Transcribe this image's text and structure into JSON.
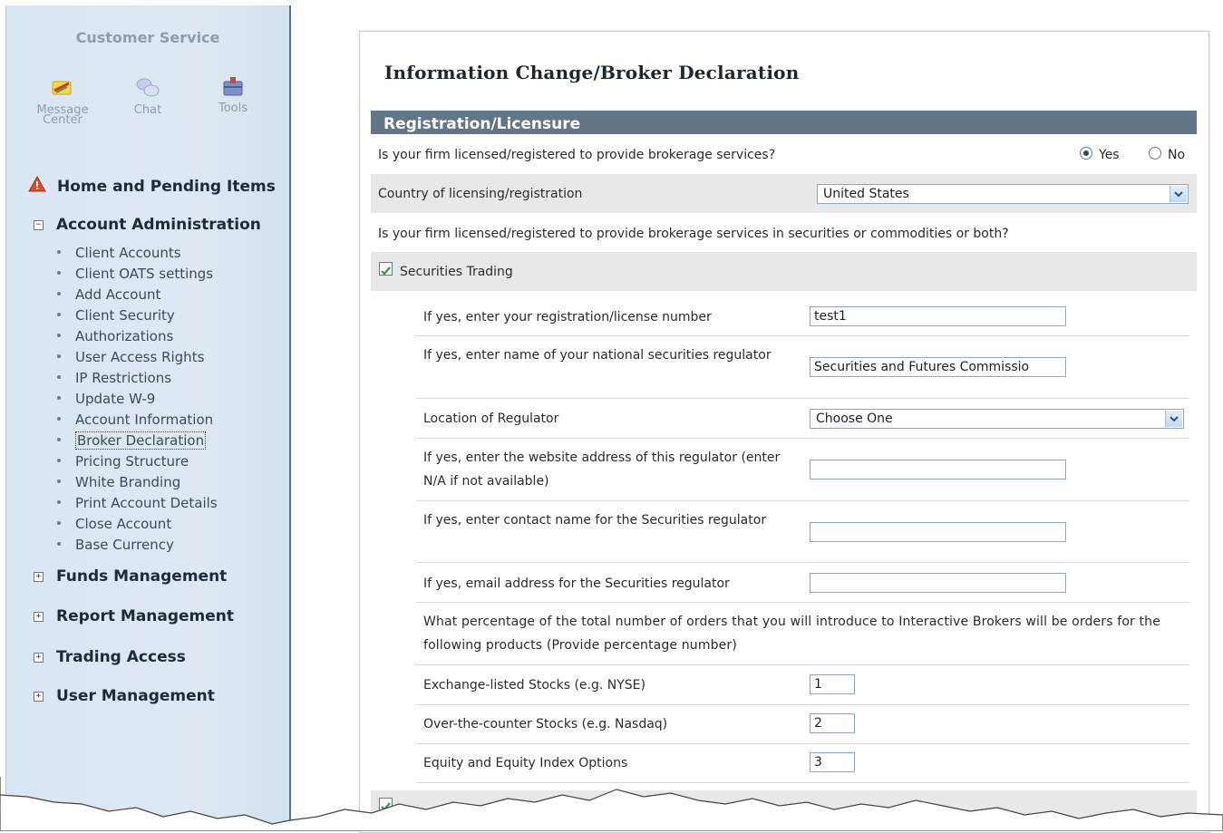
{
  "sidebar": {
    "title": "Customer Service",
    "tools": [
      {
        "label": "Message Center",
        "icon": "message-center-icon"
      },
      {
        "label": "Chat",
        "icon": "chat-icon"
      },
      {
        "label": "Tools",
        "icon": "tools-icon"
      }
    ],
    "home": "Home and Pending Items",
    "account_admin": "Account Administration",
    "account_admin_items": [
      "Client Accounts",
      "Client OATS settings",
      "Add Account",
      "Client Security",
      "Authorizations",
      "User Access Rights",
      "IP Restrictions",
      "Update W-9",
      "Account Information",
      "Broker Declaration",
      "Pricing Structure",
      "White Branding",
      "Print Account Details",
      "Close Account",
      "Base Currency"
    ],
    "current_item": "Broker Declaration",
    "collapsed_sections": [
      "Funds Management",
      "Report Management",
      "Trading Access",
      "User Management"
    ]
  },
  "main": {
    "title": "Information Change/Broker Declaration",
    "section": "Registration/Licensure",
    "q_licensed": "Is your firm licensed/registered to provide brokerage services?",
    "yes_label": "Yes",
    "no_label": "No",
    "licensed_value": "Yes",
    "country_label": "Country of licensing/registration",
    "country_value": "United States",
    "q_type": "Is your firm licensed/registered to provide brokerage services in securities or commodities or both?",
    "securities_trading_label": "Securities Trading",
    "securities_trading_checked": true,
    "fields": {
      "reg_number_label": "If yes, enter your registration/license number",
      "reg_number_value": "test1",
      "regulator_name_label": "If yes, enter name of your national securities regulator",
      "regulator_name_value": "Securities and Futures Commissio",
      "location_label": "Location of Regulator",
      "location_value": "Choose One",
      "website_label": "If yes, enter the website address of this regulator (enter N/A if not available)",
      "website_value": "",
      "contact_label": "If yes, enter contact name for the Securities regulator",
      "contact_value": "",
      "email_label": "If yes, email address for the Securities regulator",
      "email_value": ""
    },
    "pct_question": "What percentage of the total number of orders that you will introduce to Interactive Brokers will be orders for the following products (Provide percentage number)",
    "products": [
      {
        "label": "Exchange-listed Stocks (e.g. NYSE)",
        "value": "1"
      },
      {
        "label": "Over-the-counter Stocks (e.g. Nasdaq)",
        "value": "2"
      },
      {
        "label": "Equity and Equity Index Options",
        "value": "3"
      }
    ]
  },
  "colors": {
    "section_header": "#637587",
    "sidebar_bg": "#dde8f3",
    "sidebar_border": "#59708c"
  }
}
